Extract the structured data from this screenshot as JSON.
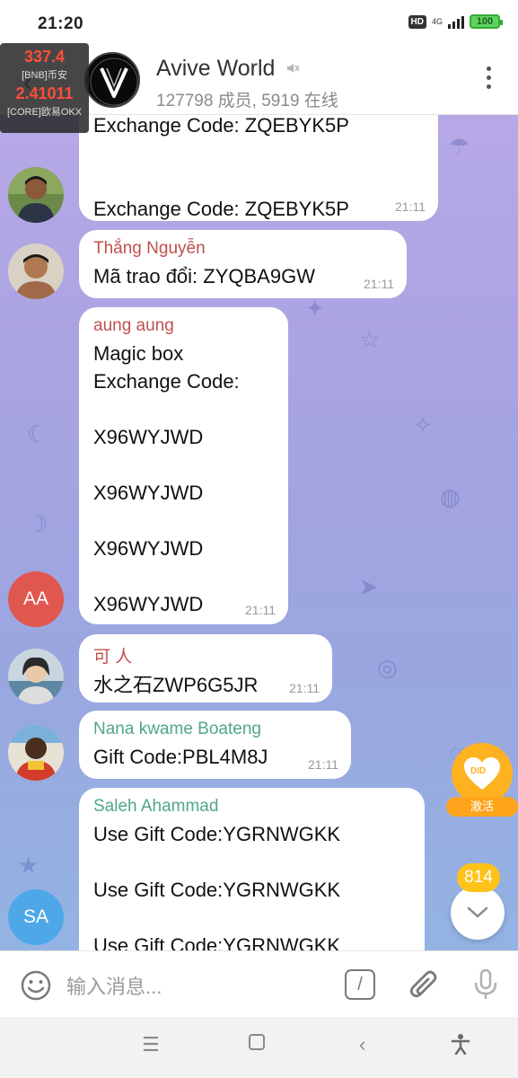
{
  "status_bar": {
    "time": "21:20",
    "hd": "HD",
    "network": "4G",
    "battery": "100"
  },
  "ticker": {
    "price1": "337.4",
    "label1": "[BNB]币安",
    "price2": "2.41011",
    "label2": "[CORE]欧易OKX"
  },
  "header": {
    "title": "Avive World",
    "subtitle": "127798 成员, 5919 在线"
  },
  "messages": [
    {
      "sender": "",
      "text": "Exchange Code: ZQEBYK5P\n\n\nExchange Code: ZQEBYK5P",
      "time": "21:11",
      "avatar": "photo"
    },
    {
      "sender": "Thắng Nguyễn",
      "sender_color": "#c0504d",
      "text": "Mã trao đổi: ZYQBA9GW",
      "time": "21:11",
      "avatar": "photo"
    },
    {
      "sender": "aung aung",
      "sender_color": "#c0504d",
      "text": "Magic box\nExchange Code:\n\nX96WYJWD\n\nX96WYJWD\n\nX96WYJWD\n\nX96WYJWD",
      "time": "21:11",
      "avatar_initials": "AA",
      "avatar_color": "#e0574f"
    },
    {
      "sender": "可 人",
      "sender_color": "#c0504d",
      "text": "水之石ZWP6G5JR",
      "time": "21:11",
      "avatar": "photo"
    },
    {
      "sender": "Nana kwame Boateng",
      "sender_color": "#4fa68a",
      "text": "Gift Code:PBL4M8J",
      "time": "21:11",
      "avatar": "photo"
    },
    {
      "sender": "Saleh Ahammad",
      "sender_color": "#4fa68a",
      "text": "Use Gift Code:YGRNWGKK\n\nUse Gift Code:YGRNWGKK\n\nUse Gift Code:YGRNWGKK",
      "time": "",
      "avatar_initials": "SA",
      "avatar_color": "#4ea8e8"
    }
  ],
  "did_badge": {
    "text": "DID",
    "label": "激活"
  },
  "unread_count": "814",
  "input": {
    "placeholder": "输入消息..."
  },
  "command_label": "/",
  "colors": {
    "accent": "#ffb21f",
    "chat_bg_top": "#b7a8e6",
    "chat_bg_bottom": "#93b3e3"
  }
}
